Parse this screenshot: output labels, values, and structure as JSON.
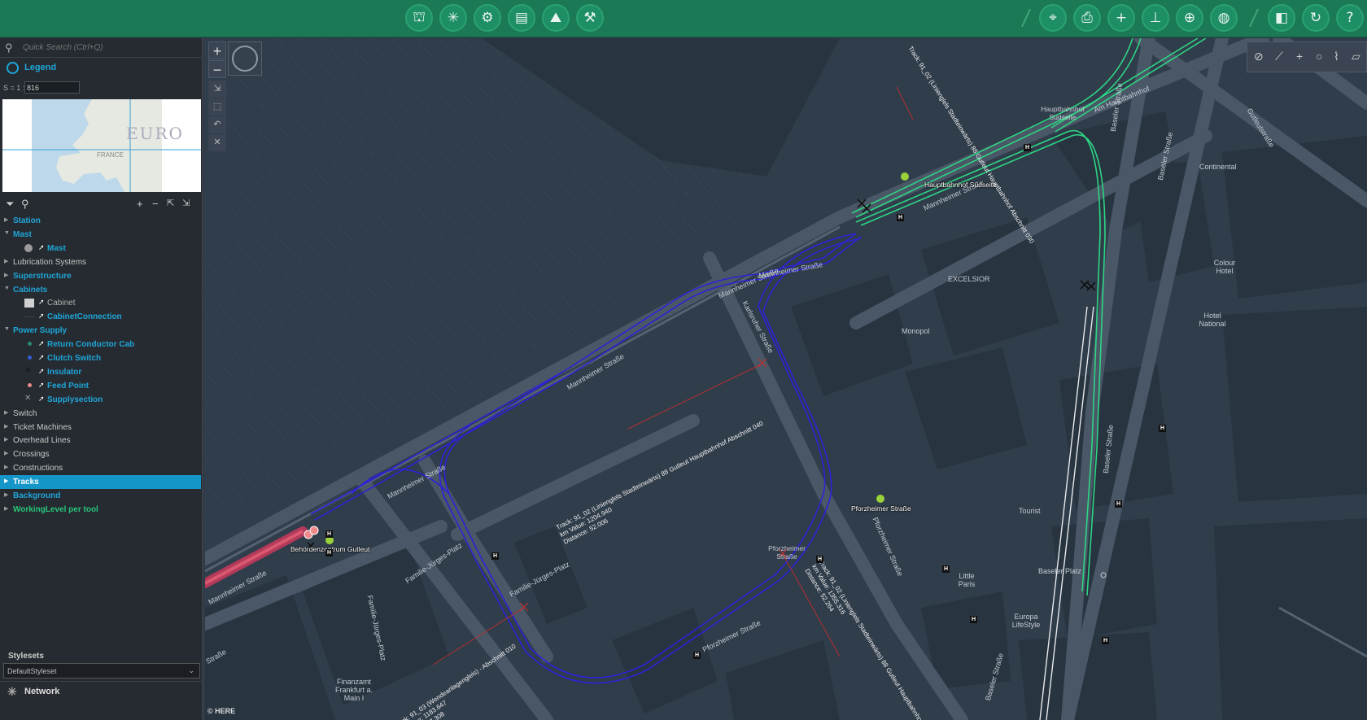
{
  "toolbar": {
    "left_icons": [
      "tower-icon",
      "network-icon",
      "switch-icon",
      "schedule-icon",
      "mountain-icon",
      "crane-icon"
    ],
    "right_icons": [
      "select-icon",
      "print-icon",
      "add-icon",
      "measure-icon",
      "add-point-icon",
      "globe-icon",
      "sidebar-icon",
      "refresh-icon",
      "help-icon"
    ]
  },
  "search": {
    "placeholder": "Quick Search (Ctrl+Q)"
  },
  "legend": {
    "title": "Legend"
  },
  "scale": {
    "label": "S = 1 :",
    "value": "816"
  },
  "minimap": {
    "label": "EURO",
    "sublabel": "FRANCE"
  },
  "tree": [
    {
      "label": "Station",
      "kind": "cat",
      "expanded": false
    },
    {
      "label": "Mast",
      "kind": "cat",
      "expanded": true
    },
    {
      "label": "Mast",
      "kind": "sub",
      "symbol": "circle",
      "color": "#9a9a9a"
    },
    {
      "label": "Lubrication Systems",
      "kind": "catg",
      "expanded": false
    },
    {
      "label": "Superstructure",
      "kind": "cat",
      "expanded": false
    },
    {
      "label": "Cabinets",
      "kind": "cat",
      "expanded": true
    },
    {
      "label": "Cabinet",
      "kind": "subg",
      "symbol": "square",
      "color": "#d0d0d0"
    },
    {
      "label": "CabinetConnection",
      "kind": "sub",
      "symbol": "line",
      "color": "#444"
    },
    {
      "label": "Power Supply",
      "kind": "cat",
      "expanded": true
    },
    {
      "label": "Return Conductor Cab",
      "kind": "sub",
      "symbol": "dot",
      "color": "#2a8a6a"
    },
    {
      "label": "Clutch Switch",
      "kind": "sub",
      "symbol": "dot",
      "color": "#3b5bd6"
    },
    {
      "label": "Insulator",
      "kind": "sub",
      "symbol": "cross",
      "color": "#111"
    },
    {
      "label": "Feed Point",
      "kind": "sub",
      "symbol": "dot",
      "color": "#f08a8a"
    },
    {
      "label": "Supplysection",
      "kind": "sub",
      "symbol": "cross",
      "color": "#999"
    },
    {
      "label": "Switch",
      "kind": "catg",
      "expanded": false
    },
    {
      "label": "Ticket Machines",
      "kind": "catg",
      "expanded": false
    },
    {
      "label": "Overhead Lines",
      "kind": "catg",
      "expanded": false
    },
    {
      "label": "Crossings",
      "kind": "catg",
      "expanded": false
    },
    {
      "label": "Constructions",
      "kind": "catg",
      "expanded": false
    },
    {
      "label": "Tracks",
      "kind": "cat",
      "expanded": false,
      "selected": true
    },
    {
      "label": "Background",
      "kind": "cat",
      "expanded": false
    },
    {
      "label": "WorkingLevel per tool",
      "kind": "catg2",
      "expanded": false
    }
  ],
  "stylesets": {
    "title": "Stylesets",
    "selected": "DefaultStyleset"
  },
  "network": {
    "label": "Network"
  },
  "map": {
    "credit": "© HERE",
    "streets": [
      "Mannheimer Straße",
      "Mannheimer Straße",
      "Mannheimer Straße",
      "Mannheimer Straße",
      "Mannheimer Straße",
      "Mannheimer Straße",
      "Karlsruher Straße",
      "Baseler Straße",
      "Baseler Straße",
      "Baseler Straße",
      "Baseler Straße",
      "Pforzheimer Straße",
      "Pforzheimer Straße",
      "Familie-Jürges-Platz",
      "Familie-Jürges-Platz",
      "Familie-Jürges-Platz",
      "Am Hauptbahnhof",
      "Gutleutstraße",
      "Straße"
    ],
    "places": [
      "Continental",
      "EXCELSIOR",
      "Colour Hotel",
      "Hotel National",
      "Monopol",
      "Tourist",
      "Little Paris",
      "Europa LifeStyle",
      "Finanzamt Frankfurt a. Main I",
      "Baseler Platz"
    ],
    "stations": [
      "Hauptbahnhof Südseite",
      "Hauptbahnhof Südseite",
      "Behördenzentrum Gutleut",
      "Pforzheimer Straße",
      "Pforzheimer Straße"
    ],
    "track_annotations": [
      "Track: 91_02 (Linienglels Stadteinwärts) 88 Gutleut Hauptbahnhof Abschnitt 040\nkm Value: 1204.940\nDistance: 52.006",
      "Track: 91_03 (Wendeanlagengleis) - Abschnitt 010\nkm Value: 1183.647\nDistance: 37.308",
      "Track: 91_02 (Linienglels Stadteinwärts) 88 Gutleut Hauptbahnhof\nkm Value: 1355.316\nDistance: 52.264",
      "Track: 91_02 (Linienglels Stadteinwärts) 88 Gutleut Hauptbahnhof Abschnitt 030"
    ]
  }
}
